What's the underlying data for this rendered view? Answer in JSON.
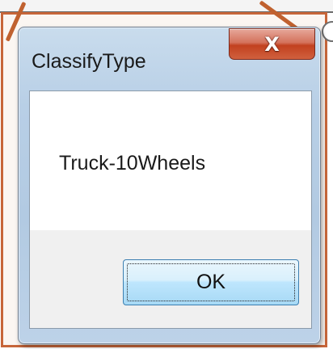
{
  "dialog": {
    "title": "ClassifyType",
    "close_glyph": "X",
    "message": "Truck-10Wheels",
    "ok_label": "OK"
  },
  "colors": {
    "annotation": "#c0612f",
    "close_button": "#c2411f",
    "ok_border": "#3c7fb1"
  },
  "icons": {
    "close": "close-icon"
  }
}
